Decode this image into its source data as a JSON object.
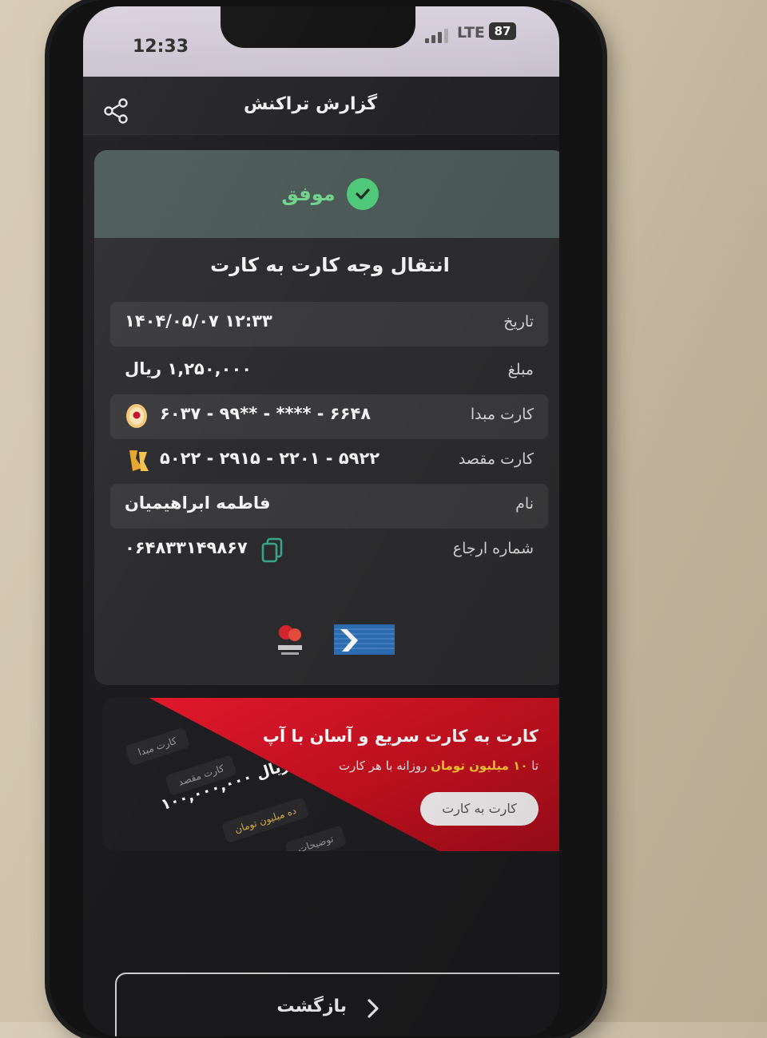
{
  "status": {
    "time": "12:33",
    "network": "LTE",
    "battery": "87"
  },
  "header": {
    "title": "گزارش تراکنش"
  },
  "result": {
    "status": "موفق",
    "transaction_type": "انتقال وجه کارت به کارت"
  },
  "details": [
    {
      "label": "تاریخ",
      "value": "۱۴۰۴/۰۵/۰۷ ۱۲:۳۳"
    },
    {
      "label": "مبلغ",
      "value": "۱,۲۵۰,۰۰۰ ریال"
    },
    {
      "label": "کارت مبدا",
      "value": "۶۰۳۷ - ۹۹** - **** - ۶۶۴۸"
    },
    {
      "label": "کارت مقصد",
      "value": "۵۰۲۲ - ۲۹۱۵ - ۲۲۰۱ - ۵۹۲۲"
    },
    {
      "label": "نام",
      "value": "فاطمه ابراهیمیان"
    },
    {
      "label": "شماره ارجاع",
      "value": "۰۶۴۸۳۳۱۴۹۸۶۷"
    }
  ],
  "promo": {
    "title": "کارت به کارت سریع و آسان با آپ",
    "subtitle_prefix": "تا ",
    "subtitle_highlight": "۱۰ میلیون تومان",
    "subtitle_suffix": " روزانه با هر کارت",
    "button": "کارت به کارت",
    "mock_source": "کارت مبدا",
    "mock_dest": "کارت مقصد",
    "mock_amount": "۱۰۰,۰۰۰,۰۰۰ ریال",
    "mock_words": "ده میلیون تومان",
    "mock_desc": "توضیحات"
  },
  "footer": {
    "back_label": "بازگشت"
  },
  "colors": {
    "success": "#4fc879",
    "promo_red": "#e6192e",
    "highlight": "#ffcc33"
  }
}
